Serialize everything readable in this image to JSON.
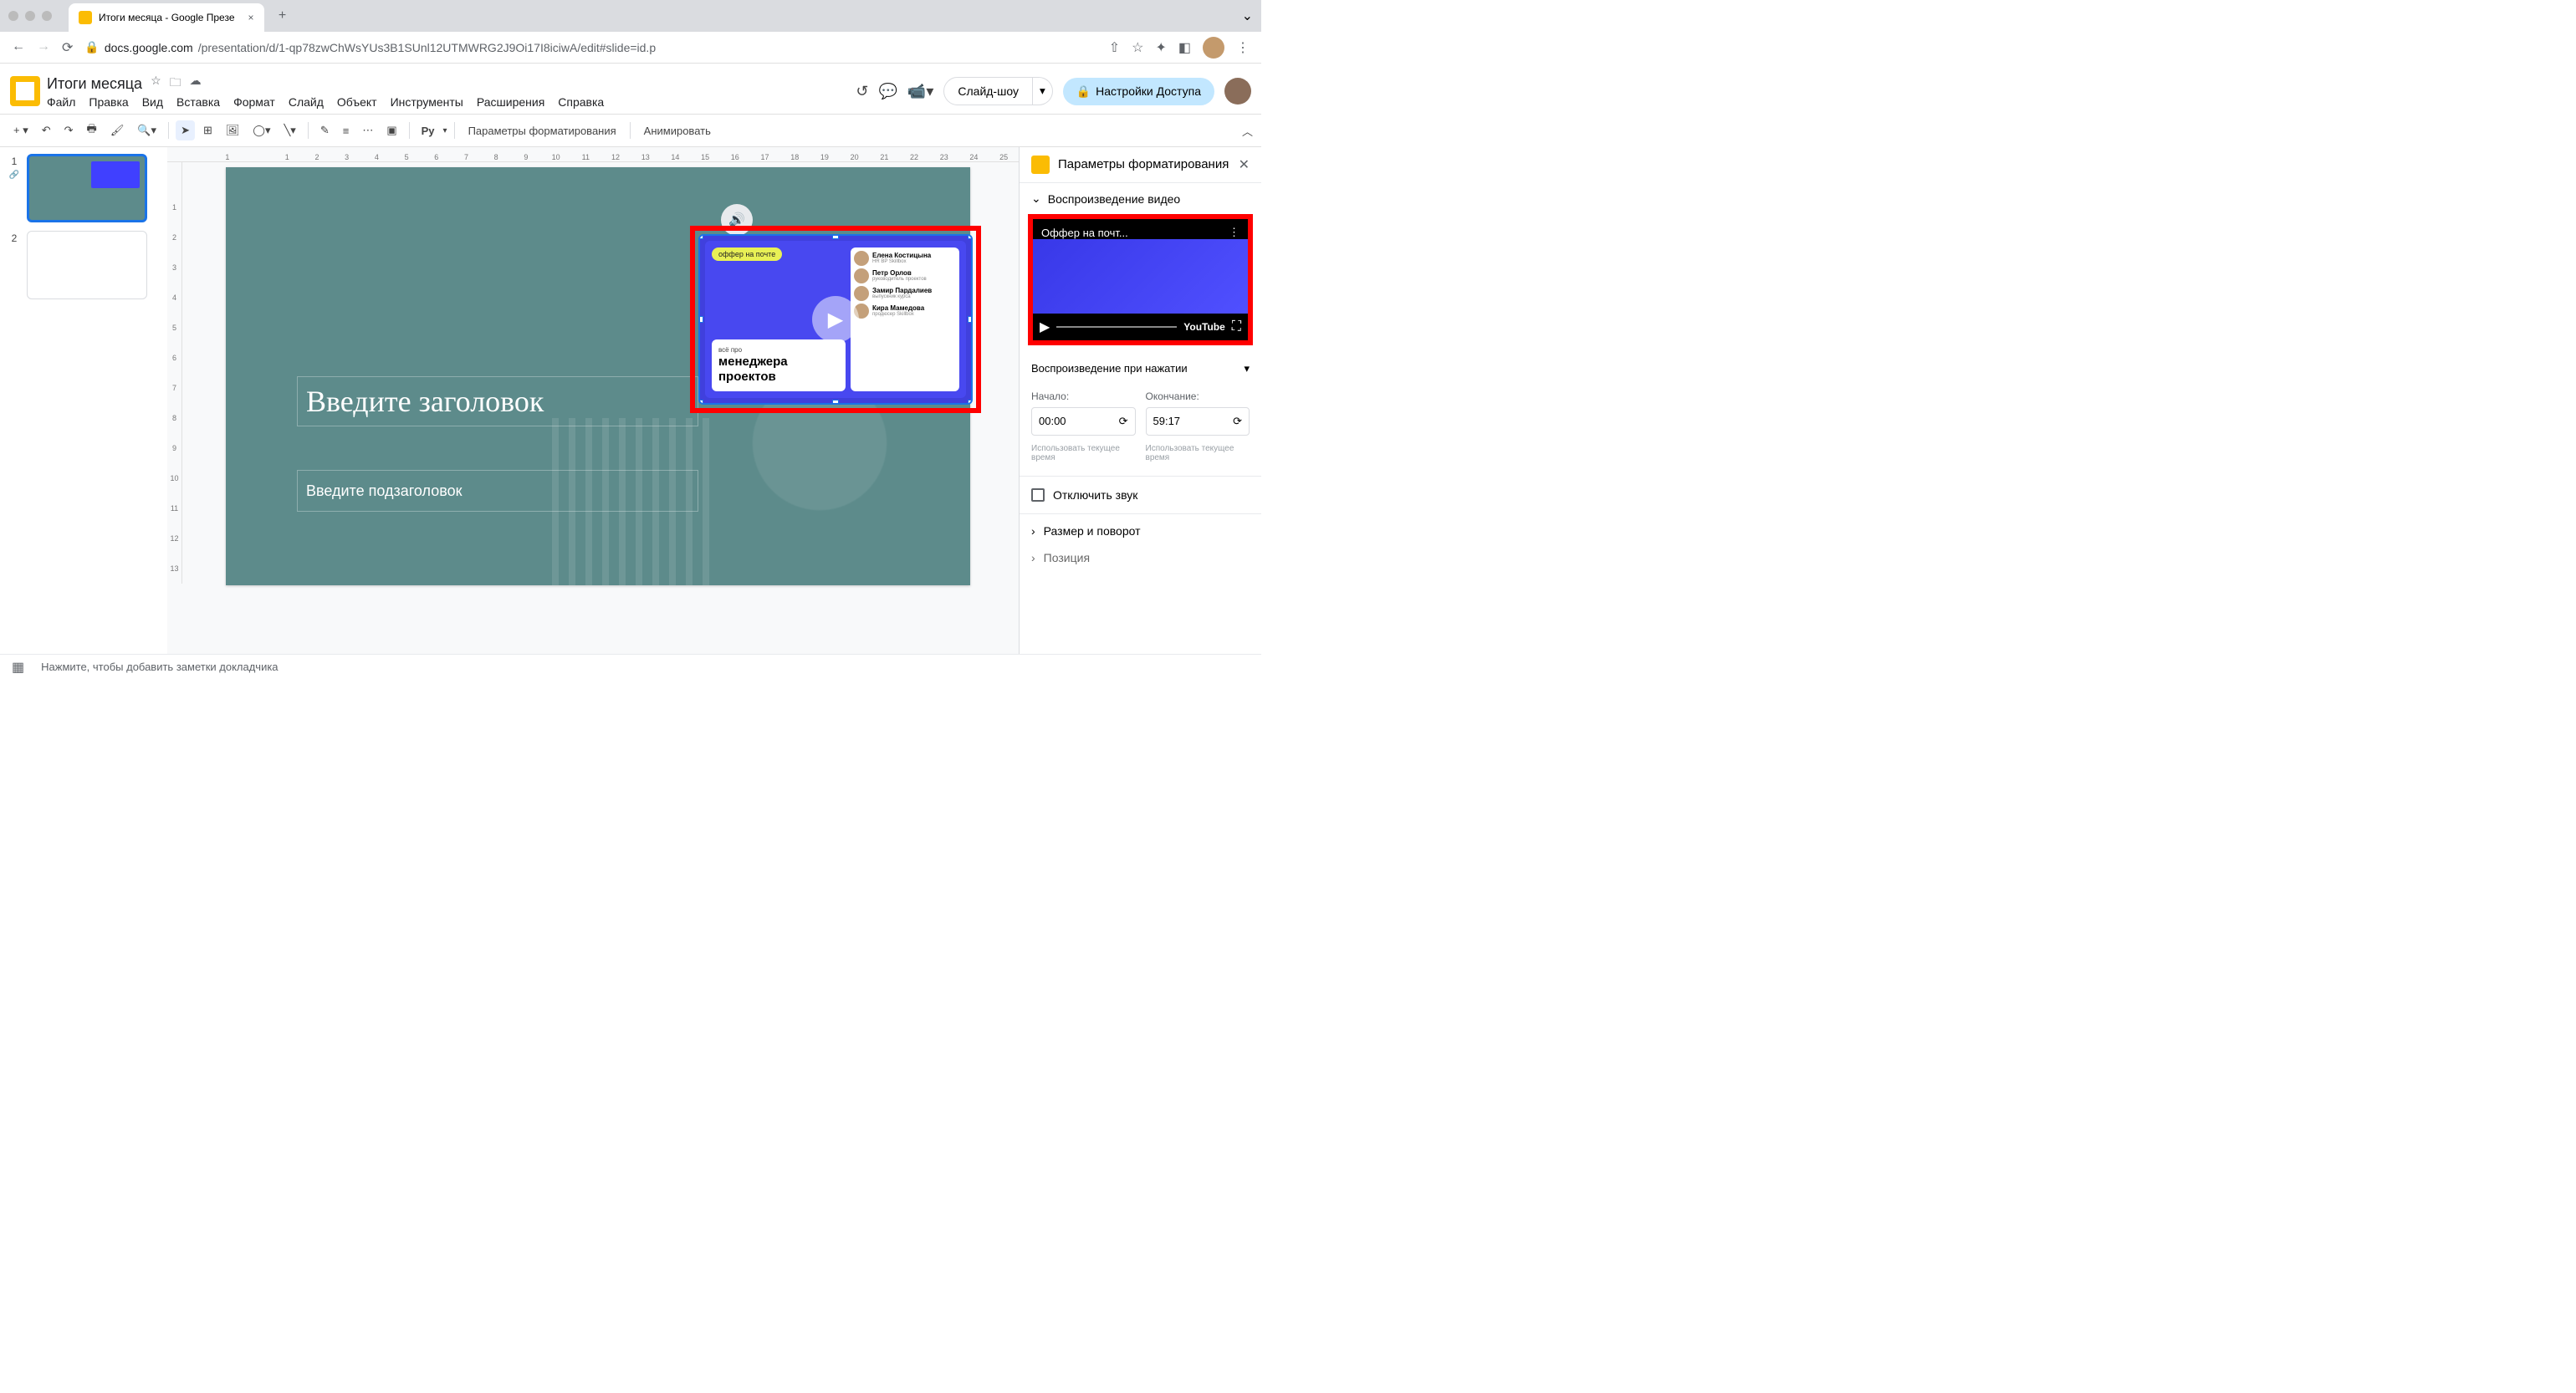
{
  "browser": {
    "tab_title": "Итоги месяца - Google Презе",
    "url_domain": "docs.google.com",
    "url_path": "/presentation/d/1-qp78zwChWsYUs3B1SUnl12UTMWRG2J9Oi17I8iciwA/edit#slide=id.p"
  },
  "app": {
    "doc_title": "Итоги месяца",
    "menus": [
      "Файл",
      "Правка",
      "Вид",
      "Вставка",
      "Формат",
      "Слайд",
      "Объект",
      "Инструменты",
      "Расширения",
      "Справка"
    ],
    "slideshow_btn": "Слайд-шоу",
    "share_btn": "Настройки Доступа"
  },
  "toolbar": {
    "format_options": "Параметры форматирования",
    "animate": "Анимировать",
    "py_label": "Py"
  },
  "filmstrip": {
    "slides": [
      {
        "num": "1",
        "active": true
      },
      {
        "num": "2",
        "active": false
      }
    ]
  },
  "ruler_h": [
    "1",
    "",
    "1",
    "2",
    "3",
    "4",
    "5",
    "6",
    "7",
    "8",
    "9",
    "10",
    "11",
    "12",
    "13",
    "14",
    "15",
    "16",
    "17",
    "18",
    "19",
    "20",
    "21",
    "22",
    "23",
    "24",
    "25"
  ],
  "ruler_v": [
    "",
    "1",
    "2",
    "3",
    "4",
    "5",
    "6",
    "7",
    "8",
    "9",
    "10",
    "11",
    "12",
    "13"
  ],
  "slide": {
    "title_placeholder": "Введите заголовок",
    "subtitle_placeholder": "Введите подзаголовок",
    "video_badge": "оффер на почте",
    "video_card_small": "всё про",
    "video_card_big1": "менеджера",
    "video_card_big2": "проектов",
    "people": [
      {
        "name": "Елена Костицына",
        "role": "HR BP Skillbox"
      },
      {
        "name": "Петр Орлов",
        "role": "руководитель проектов"
      },
      {
        "name": "Замир Пардалиев",
        "role": "выпускник курса"
      },
      {
        "name": "Кира Мамедова",
        "role": "продюсер Skillbox"
      }
    ]
  },
  "panel": {
    "title": "Параметры форматирования",
    "section_playback": "Воспроизведение видео",
    "preview_title": "Оффер на почт...",
    "youtube_label": "YouTube",
    "playback_mode": "Воспроизведение при нажатии",
    "start_label": "Начало:",
    "end_label": "Окончание:",
    "start_value": "00:00",
    "end_value": "59:17",
    "use_current_time": "Использовать текущее время",
    "mute_label": "Отключить звук",
    "section_size": "Размер и поворот",
    "section_position": "Позиция"
  },
  "bottom": {
    "speaker_notes": "Нажмите, чтобы добавить заметки докладчика"
  }
}
